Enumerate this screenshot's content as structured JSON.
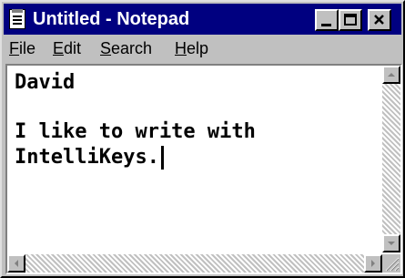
{
  "window": {
    "title": "Untitled - Notepad",
    "icon": "notepad-icon",
    "controls": [
      "minimize-icon",
      "maximize-icon",
      "close-icon"
    ]
  },
  "menu": {
    "file": {
      "first": "F",
      "rest": "ile"
    },
    "edit": {
      "first": "E",
      "rest": "dit"
    },
    "search": {
      "first": "S",
      "rest": "earch"
    },
    "help": {
      "first": "H",
      "rest": "elp"
    }
  },
  "document": {
    "lines": [
      "David",
      "",
      "I like to write with",
      "IntelliKeys."
    ]
  },
  "colors": {
    "title_bar": "#000080",
    "chrome": "#c0c0c0",
    "text": "#000000"
  }
}
